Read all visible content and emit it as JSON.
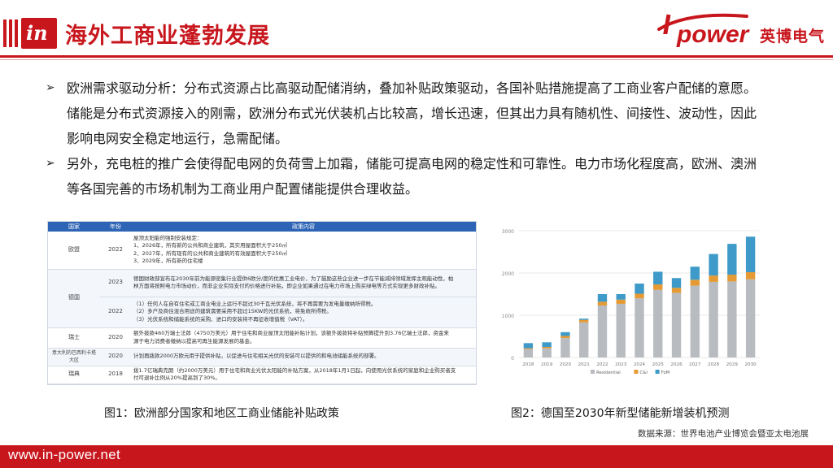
{
  "header": {
    "title": "海外工商业蓬勃发展",
    "logo_mark": "in",
    "brand_name": "power",
    "brand_cn": "英博电气",
    "brand_color": "#c8161d"
  },
  "bullets": [
    {
      "lines": [
        "欧洲需求驱动分析：分布式资源占比高驱动配储消纳，叠加补贴政策驱动，各国补贴措施提高了工商业客户配储的意愿。",
        "储能是分布式资源接入的刚需，欧洲分布式光伏装机占比较高，增长迅速，但其出力具有随机性、间接性、波动性，因此",
        "影响电网安全稳定地运行，急需配储。"
      ]
    },
    {
      "lines": [
        "另外，充电桩的推广会使得配电网的负荷雪上加霜，储能可提高电网的稳定性和可靠性。电力市场化程度高，欧洲、澳洲",
        "等各国完善的市场机制为工商业用户配置储能提供合理收益。"
      ]
    }
  ],
  "policy_table": {
    "headers": [
      "国家",
      "年份",
      "政策内容"
    ],
    "rows": [
      {
        "country": "欧盟",
        "year": "2022",
        "content": [
          "屋顶太阳能的强制安装规定：",
          "1、2026年，所有新的公共和商业建筑，其实用屋面积大于250㎡",
          "2、2027年，所有现有的公共和商业建筑的有效屋面积大于250㎡",
          "3、2029年，所有新的住宅楼"
        ]
      },
      {
        "country": "德国",
        "year": "2023",
        "content": [
          "德国财政部宣布在2030年前为能源密集行业提供6欧分/度的优惠工业电价，为了鼓励这些企业进一步在节能减排领域发挥主观能动性，柏",
          "林方面将按照电力市场动价，而非企业实际支付的价格进行补贴，即企业如果通过在电力市场上购买绿电等方式实现更多财政补贴。"
        ]
      },
      {
        "country": "",
        "year": "2022",
        "content": [
          "（1）任何人在自有住宅或工商业电业上运行不超过30千瓦光伏系统，将不再需要为发电量缴纳所得税。",
          "（2）多户及商住混合用途的建筑需要采用不超过15KW的光伏系统，将免收所得税。",
          "（3）光伏系统和储能系统的采购、进口的安装将不再征收增值税（VAT）。"
        ]
      },
      {
        "country": "瑞士",
        "year": "2020",
        "content": [
          "额外拨款460万瑞士法郎（4750万美元）用于住宅和商业屋顶太阳能补贴计划，该额外拨款将补贴预算提升到3.76亿瑞士法郎，资金来",
          "源于电力消费者缴纳以提高可再生能源发展的基金。"
        ]
      },
      {
        "country": "意大利的巴西利卡塔大区",
        "year": "2020",
        "content": [
          "计划再拨款2000万欧元用于提供补贴，以促进与住宅相关光伏的安装可以提供的和电池储能系统的部署。"
        ]
      },
      {
        "country": "瑞典",
        "year": "2018",
        "content": [
          "拨1.7亿瑞典克朗（约2000万美元）用于住宅和商业光伏太阳能的补贴方案，从2018年1月1日起，向使用光伏系统的家庭和企业购买者支",
          "付可退补比例从20%提高到了30%。"
        ]
      }
    ]
  },
  "chart_data": {
    "type": "bar",
    "stacked": true,
    "categories": [
      "2018",
      "2019",
      "2020",
      "2021",
      "2022",
      "2023",
      "2024",
      "2025",
      "2026",
      "2027",
      "2028",
      "2029",
      "2030"
    ],
    "series": [
      {
        "name": "Residential",
        "color": "#b8bcc0",
        "values": [
          200,
          220,
          460,
          830,
          1230,
          1270,
          1400,
          1600,
          1530,
          1700,
          1790,
          1800,
          1850
        ]
      },
      {
        "name": "C&I",
        "color": "#e59a34",
        "values": [
          20,
          30,
          50,
          60,
          90,
          100,
          110,
          130,
          120,
          140,
          150,
          160,
          170
        ]
      },
      {
        "name": "FoM",
        "color": "#3e9ac8",
        "values": [
          120,
          110,
          90,
          30,
          180,
          130,
          240,
          300,
          230,
          310,
          510,
          730,
          840
        ]
      }
    ],
    "yticks": [
      "0",
      "1000",
      "2000",
      "3000"
    ],
    "ylim": [
      0,
      3000
    ]
  },
  "captions": {
    "fig1": "图1：欧洲部分国家和地区工商业储能补贴政策",
    "fig2": "图2：德国至2030年新型储能新增装机预测",
    "source": "数据来源：世界电池产业博览会暨亚太电池展"
  },
  "footer": {
    "url": "www.in-power.net"
  }
}
